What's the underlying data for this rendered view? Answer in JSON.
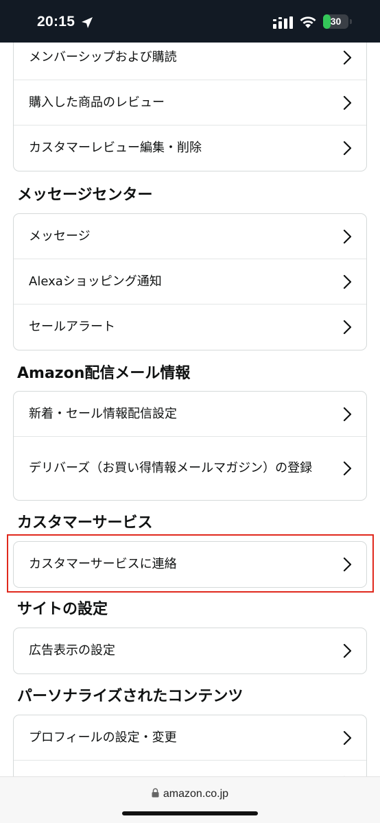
{
  "status_bar": {
    "time": "20:15",
    "battery": "30",
    "battery_level": 0.3,
    "icons": [
      "location-arrow-icon",
      "signal-icon",
      "wifi-icon",
      "battery-icon"
    ]
  },
  "card_top": {
    "items": [
      {
        "label": "メンバーシップおよび購読"
      },
      {
        "label": "購入した商品のレビュー"
      },
      {
        "label": "カスタマーレビュー編集・削除"
      }
    ]
  },
  "sections": [
    {
      "title": "メッセージセンター",
      "items": [
        {
          "label": "メッセージ"
        },
        {
          "label": "Alexaショッピング通知"
        },
        {
          "label": "セールアラート"
        }
      ]
    },
    {
      "title": "Amazon配信メール情報",
      "items": [
        {
          "label": "新着・セール情報配信設定"
        },
        {
          "label": "デリバーズ（お買い得情報メールマガジン）の登録"
        }
      ]
    },
    {
      "title": "カスタマーサービス",
      "items": [
        {
          "label": "カスタマーサービスに連絡"
        }
      ]
    },
    {
      "title": "サイトの設定",
      "items": [
        {
          "label": "広告表示の設定"
        }
      ]
    },
    {
      "title": "パーソナライズされたコンテンツ",
      "items": [
        {
          "label": "プロフィールの設定・変更"
        },
        {
          "label": ""
        }
      ]
    }
  ],
  "browser": {
    "url": "amazon.co.jp"
  },
  "colors": {
    "status_bar_bg": "#121a24",
    "highlight_border": "#e0281c",
    "card_border": "#d5d9d9",
    "battery_green": "#34c759"
  }
}
